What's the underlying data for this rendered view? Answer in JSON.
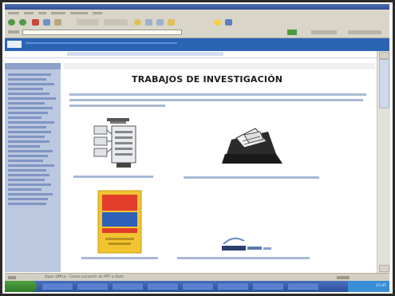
{
  "page": {
    "title": "TRABAJOS DE INVESTIGACIÓN"
  },
  "statusbar": {
    "text": "Open Office - Como convertir de PPT a flash"
  },
  "taskbar": {
    "clock": "11:45"
  },
  "colors": {
    "site_header": "#2c64b4",
    "sidebar": "#bcc8df",
    "link": "#5a74a8",
    "title": "#1c1c1c",
    "taskbar": "#2b4f9c"
  },
  "icons": [
    "back-icon",
    "forward-icon",
    "stop-icon",
    "refresh-icon",
    "home-icon",
    "search-icon",
    "favorites-icon",
    "go-icon",
    "scanner-icon",
    "database-icon",
    "book-icon",
    "openoffice-logo-icon"
  ]
}
